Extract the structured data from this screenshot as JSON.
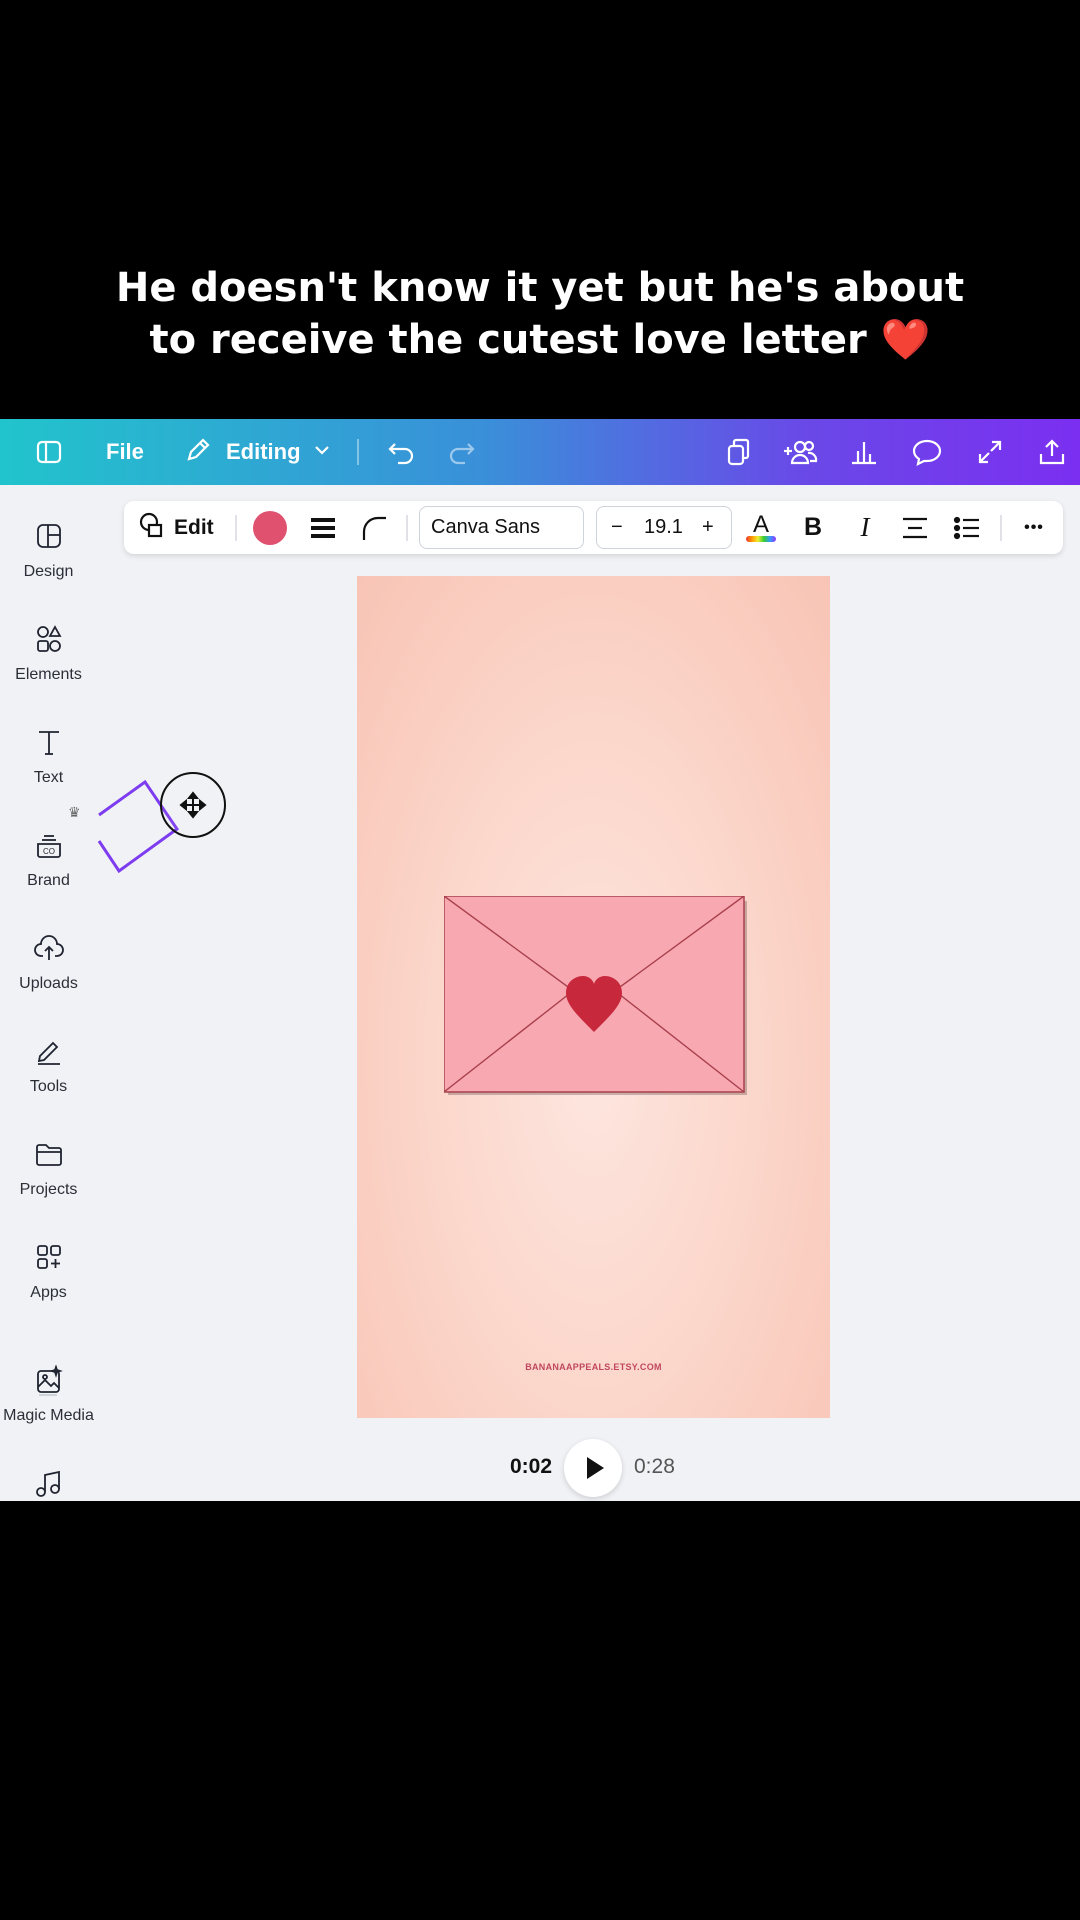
{
  "caption": {
    "line1": "He doesn't know it yet but he's about",
    "line2": "to receive the cutest love letter",
    "emoji": "❤️"
  },
  "topbar": {
    "file_label": "File",
    "mode_label": "Editing",
    "icons": [
      "sidebar-toggle-icon",
      "pencil-icon",
      "chevron-down-icon",
      "undo-icon",
      "redo-icon",
      "resize-icon",
      "share-people-icon",
      "analytics-icon",
      "comment-icon",
      "fullscreen-icon",
      "upload-share-icon"
    ]
  },
  "sidebar": {
    "items": [
      {
        "label": "Design",
        "icon": "design-icon"
      },
      {
        "label": "Elements",
        "icon": "elements-icon"
      },
      {
        "label": "Text",
        "icon": "text-icon"
      },
      {
        "label": "Brand",
        "icon": "brand-icon"
      },
      {
        "label": "Uploads",
        "icon": "uploads-icon"
      },
      {
        "label": "Tools",
        "icon": "tools-icon"
      },
      {
        "label": "Projects",
        "icon": "projects-icon"
      },
      {
        "label": "Apps",
        "icon": "apps-icon"
      },
      {
        "label": "Magic Media",
        "icon": "magic-media-icon"
      },
      {
        "label": "",
        "icon": "music-icon"
      }
    ]
  },
  "context_toolbar": {
    "edit_label": "Edit",
    "fill_color": "#e0506f",
    "font_name": "Canva Sans",
    "font_size": "19.1",
    "minus": "−",
    "plus": "+",
    "bold": "B",
    "italic": "I",
    "text_color_glyph": "A",
    "more": "•••"
  },
  "canvas": {
    "watermark": "BANANAAPPEALS.ETSY.COM",
    "envelope_color": "#f8a8b0",
    "heart_color": "#c8283c",
    "background_color": "#fbd4c8"
  },
  "playback": {
    "current_time": "0:02",
    "total_time": "0:28"
  },
  "colors": {
    "accent_purple": "#7b2ff0",
    "accent_teal": "#21c4cc",
    "selection": "#7d3cf0"
  }
}
